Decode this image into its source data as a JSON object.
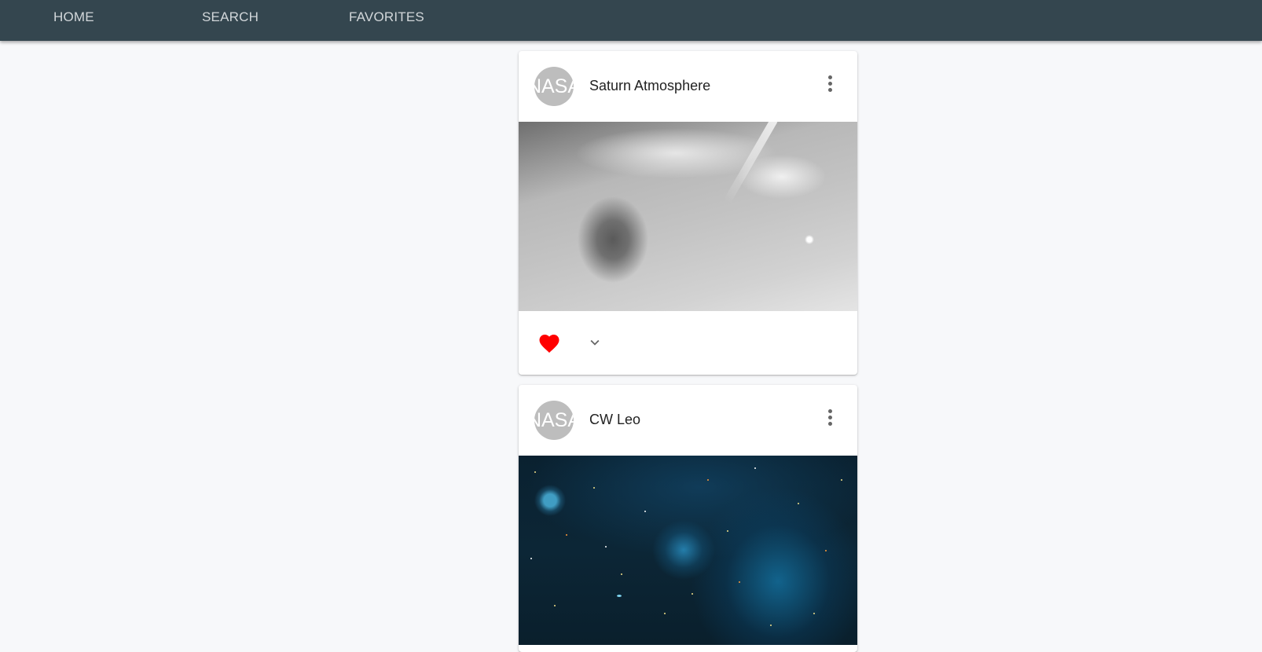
{
  "nav": {
    "home": "HOME",
    "search": "SEARCH",
    "favorites": "FAVORITES"
  },
  "cards": [
    {
      "avatar_text": "NASA",
      "title": "Saturn Atmosphere",
      "image": "grayscale photo of Saturn's atmosphere storms",
      "favorited": true,
      "heart_color": "#ff0000"
    },
    {
      "avatar_text": "NASA",
      "title": "CW Leo",
      "image": "infrared star field with blue nebula"
    }
  ],
  "colors": {
    "topbar": "#34464f",
    "nav_text": "#d2d7da",
    "background": "#f7f8fa",
    "avatar": "#bdbdbd"
  }
}
